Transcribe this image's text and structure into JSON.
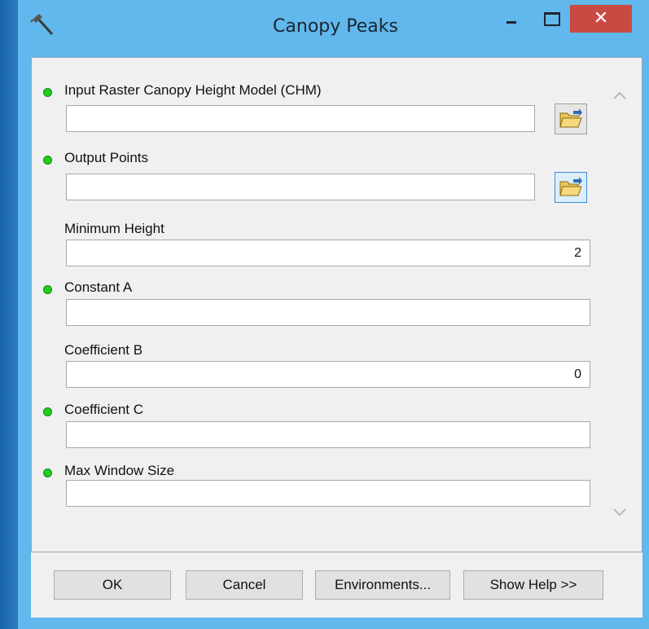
{
  "window": {
    "title": "Canopy Peaks",
    "close_symbol": "✕",
    "app_icon": "hammer-icon"
  },
  "params": [
    {
      "label": "Input Raster Canopy Height Model (CHM)",
      "required": true,
      "value": "",
      "browse": true
    },
    {
      "label": "Output Points",
      "required": true,
      "value": "",
      "browse": true
    },
    {
      "label": "Minimum Height",
      "required": false,
      "value": "2",
      "browse": false
    },
    {
      "label": "Constant A",
      "required": true,
      "value": "",
      "browse": false
    },
    {
      "label": "Coefficient B",
      "required": false,
      "value": "0",
      "browse": false
    },
    {
      "label": "Coefficient C",
      "required": true,
      "value": "",
      "browse": false
    },
    {
      "label": "Max Window Size",
      "required": true,
      "value": "",
      "browse": false
    }
  ],
  "buttons": {
    "ok": "OK",
    "cancel": "Cancel",
    "environments": "Environments...",
    "show_help": "Show Help >>"
  },
  "colors": {
    "titlebar": "#61b8ec",
    "close": "#c94a43",
    "required_dot": "#1ecf1e"
  }
}
